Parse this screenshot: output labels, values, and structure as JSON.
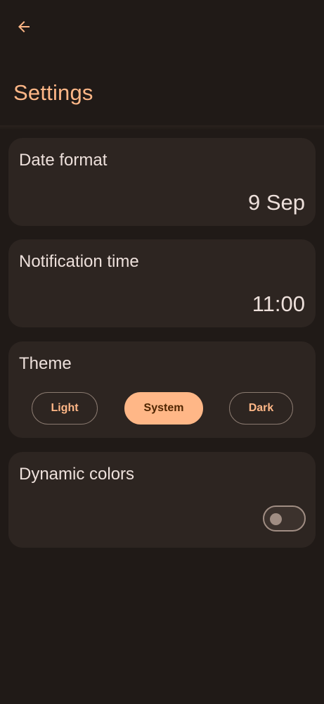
{
  "header": {
    "title": "Settings",
    "back_icon": "arrow-back-icon"
  },
  "date_format": {
    "label": "Date format",
    "value": "9 Sep"
  },
  "notification_time": {
    "label": "Notification time",
    "value": "11:00"
  },
  "theme": {
    "label": "Theme",
    "options": [
      {
        "label": "Light",
        "selected": false
      },
      {
        "label": "System",
        "selected": true
      },
      {
        "label": "Dark",
        "selected": false
      }
    ]
  },
  "dynamic_colors": {
    "label": "Dynamic colors",
    "enabled": false
  },
  "colors": {
    "background": "#201a17",
    "surface": "#2d2521",
    "accent": "#ffb787",
    "on_accent": "#4f2500",
    "text": "#ede0db",
    "outline": "#8a7a70"
  }
}
